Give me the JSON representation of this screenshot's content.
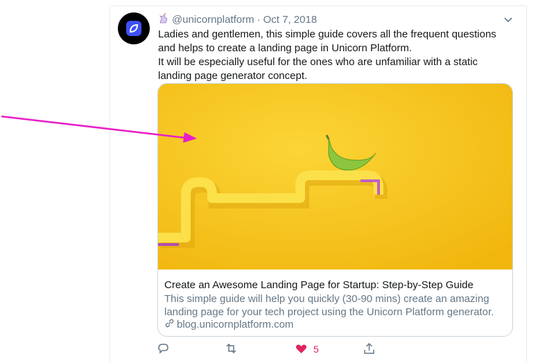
{
  "tweet": {
    "author_handle": "@unicornplatform",
    "separator": "·",
    "date": "Oct 7, 2018",
    "text_line1": "Ladies and gentlemen, this simple guide covers all the frequent questions and helps to create a landing page in Unicorn Platform.",
    "text_line2": "It will be especially useful for the ones who are unfamiliar with a static landing page generator concept."
  },
  "link_card": {
    "title": "Create an Awesome Landing Page for Startup: Step-by-Step Guide",
    "description": "This simple guide will help you quickly (30-90 mins) create an amazing landing page for your tech project using the Unicorn Platform generator.",
    "domain": "blog.unicornplatform.com"
  },
  "actions": {
    "like_count": "5"
  },
  "colors": {
    "accent_like": "#e0245e",
    "secondary_text": "#657786",
    "annotation_arrow": "#e81ec8",
    "card_background": "#f5c518"
  },
  "icons": [
    "unicorn-icon",
    "chevron-down-icon",
    "link-icon",
    "reply-icon",
    "retweet-icon",
    "heart-icon",
    "share-icon"
  ]
}
